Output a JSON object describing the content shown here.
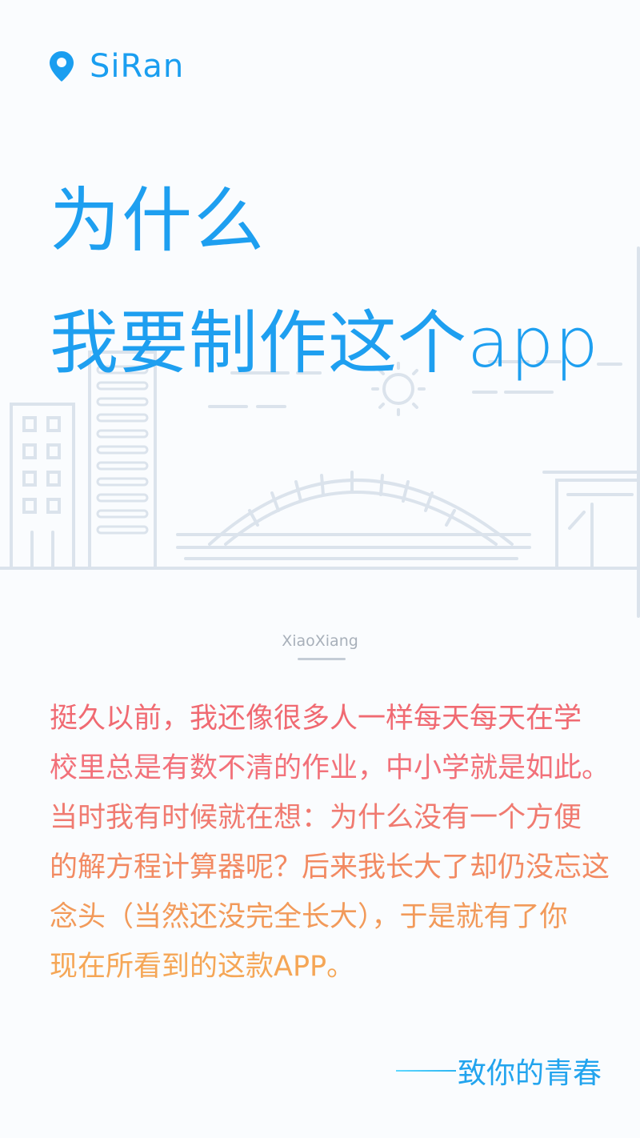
{
  "brand": {
    "name": "SiRan",
    "icon": "location-pin-icon",
    "color": "#1a9ef0"
  },
  "headline": {
    "line1": "为什么",
    "line2": "我要制作这个app"
  },
  "author": {
    "name": "XiaoXiang"
  },
  "story": {
    "lines": [
      "挺久以前，我还像很多人一样每天每天在学",
      "校里总是有数不清的作业，中小学就是如此。",
      "当时我有时候就在想：为什么没有一个方便",
      "的解方程计算器呢？后来我长大了却仍没忘这",
      "念头（当然还没完全长大），于是就有了你",
      "现在所看到的这款APP。"
    ]
  },
  "signature": {
    "text": "致你的青春",
    "prefix": "——"
  },
  "colors": {
    "accent": "#1e9ff0",
    "text_warm_start": "#f06a72",
    "text_warm_end": "#f5a656"
  }
}
